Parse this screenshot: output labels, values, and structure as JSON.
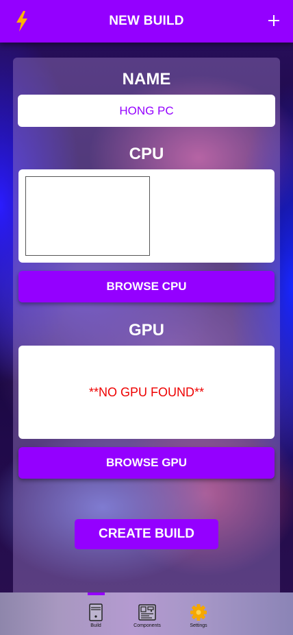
{
  "header": {
    "title": "NEW BUILD",
    "left_icon": "lightning-bolt-icon",
    "right_icon": "plus-icon"
  },
  "name_section": {
    "title": "NAME",
    "value": "HONG PC"
  },
  "cpu_section": {
    "title": "CPU",
    "browse_label": "BROWSE CPU"
  },
  "gpu_section": {
    "title": "GPU",
    "empty_message": "**NO GPU FOUND**",
    "browse_label": "BROWSE GPU"
  },
  "create_label": "CREATE BUILD",
  "tabs": [
    {
      "label": "Build",
      "icon": "pc-tower-icon",
      "active": true
    },
    {
      "label": "Components",
      "icon": "motherboard-icon",
      "active": false
    },
    {
      "label": "Settings",
      "icon": "gear-icon",
      "active": false
    }
  ],
  "colors": {
    "accent": "#9400ff",
    "error": "#ee0000",
    "bolt": "#ffb300"
  }
}
